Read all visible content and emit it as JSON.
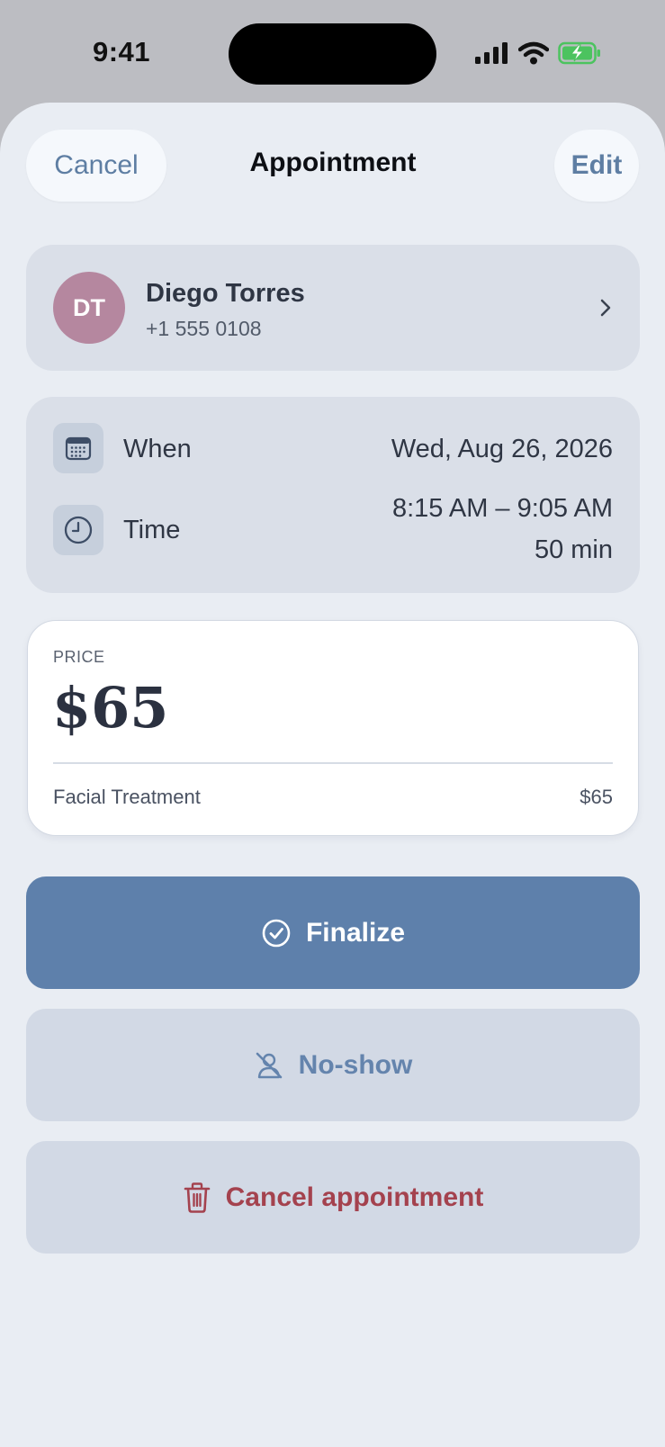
{
  "status_bar": {
    "time": "9:41",
    "icons": [
      "signal-icon",
      "wifi-icon",
      "battery-charging-icon"
    ]
  },
  "nav": {
    "cancel_label": "Cancel",
    "title": "Appointment",
    "edit_label": "Edit"
  },
  "client": {
    "initials": "DT",
    "name": "Diego Torres",
    "phone": "+1 555 0108",
    "avatar_color": "#b5879f"
  },
  "schedule": {
    "when_label": "When",
    "when_value": "Wed, Aug 26, 2026",
    "time_label": "Time",
    "time_range": "8:15 AM – 9:05 AM",
    "duration": "50 min"
  },
  "price": {
    "label": "PRICE",
    "amount": "$65",
    "items": [
      {
        "name": "Facial Treatment",
        "price": "$65"
      }
    ]
  },
  "actions": {
    "finalize_label": "Finalize",
    "noshow_label": "No-show",
    "cancel_label": "Cancel appointment"
  },
  "colors": {
    "accent": "#5e80ab",
    "destructive": "#a4424e",
    "sheet_background": "#e9edf3",
    "card_background": "#dadfe8"
  }
}
